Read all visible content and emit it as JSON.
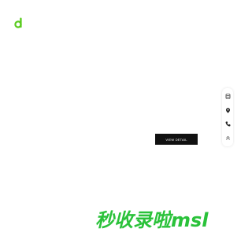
{
  "logo": {
    "icon": "green-d-logo",
    "color": "#5acb1f"
  },
  "toolbar": {
    "items": [
      {
        "icon": "database-icon"
      },
      {
        "icon": "location-pin-icon"
      },
      {
        "icon": "phone-icon"
      },
      {
        "icon": "chevron-double-up-icon"
      }
    ]
  },
  "hero": {
    "button_label": "VIEW DETAIL"
  },
  "footer": {
    "brand_text": "秒收录啦msl",
    "color": "#2ac23a"
  }
}
